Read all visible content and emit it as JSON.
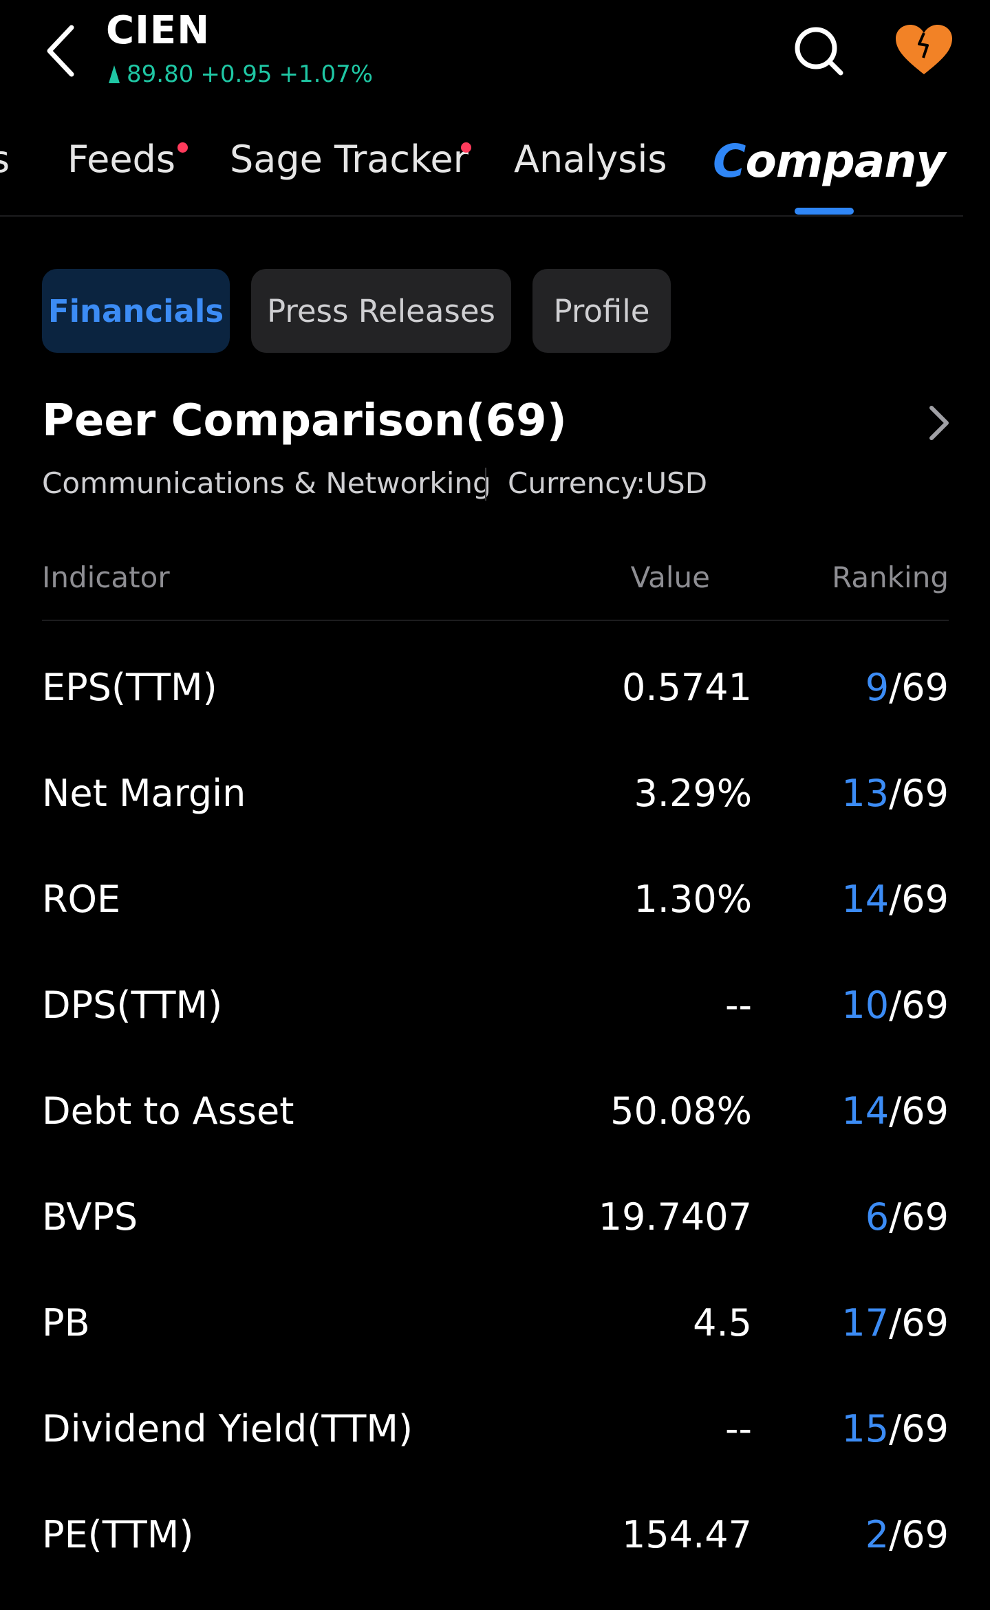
{
  "header": {
    "ticker": "CIEN",
    "price": "89.80",
    "change": "+0.95",
    "change_pct": "+1.07%",
    "price_color": "#1fc7a4"
  },
  "top_tabs": {
    "partial_left": "s",
    "feeds": "Feeds",
    "sage_tracker": "Sage Tracker",
    "analysis": "Analysis",
    "company_accent": "C",
    "company_rest": "ompany"
  },
  "sub_tabs": {
    "financials": "Financials",
    "press_releases": "Press Releases",
    "profile": "Profile"
  },
  "section": {
    "title": "Peer Comparison(69)",
    "industry": "Communications & Networking",
    "currency": "Currency:USD"
  },
  "table": {
    "headers": {
      "indicator": "Indicator",
      "value": "Value",
      "ranking": "Ranking"
    },
    "rows": [
      {
        "indicator": "EPS(TTM)",
        "value": "0.5741",
        "rank": "9",
        "total": "/69"
      },
      {
        "indicator": "Net Margin",
        "value": "3.29%",
        "rank": "13",
        "total": "/69"
      },
      {
        "indicator": "ROE",
        "value": "1.30%",
        "rank": "14",
        "total": "/69"
      },
      {
        "indicator": "DPS(TTM)",
        "value": "--",
        "rank": "10",
        "total": "/69"
      },
      {
        "indicator": "Debt to Asset",
        "value": "50.08%",
        "rank": "14",
        "total": "/69"
      },
      {
        "indicator": "BVPS",
        "value": "19.7407",
        "rank": "6",
        "total": "/69"
      },
      {
        "indicator": "PB",
        "value": "4.5",
        "rank": "17",
        "total": "/69"
      },
      {
        "indicator": "Dividend Yield(TTM)",
        "value": "--",
        "rank": "15",
        "total": "/69"
      },
      {
        "indicator": "PE(TTM)",
        "value": "154.47",
        "rank": "2",
        "total": "/69"
      }
    ]
  },
  "icons": {
    "back": "chevron-left-icon",
    "search": "search-icon",
    "favorite": "heart-icon",
    "section_more": "chevron-right-icon",
    "up_arrow": "triangle-up-icon"
  },
  "colors": {
    "accent": "#2f86f6",
    "rank_highlight": "#3c8cf5",
    "notification_dot": "#ff3b5c",
    "favorite": "#f28226"
  }
}
